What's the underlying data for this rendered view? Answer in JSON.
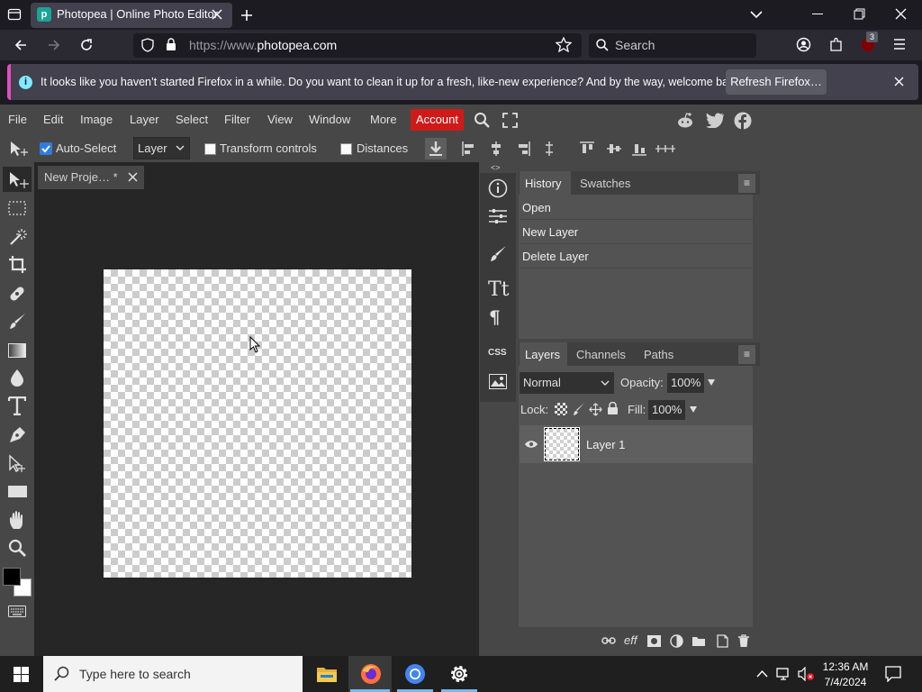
{
  "browser": {
    "tab_title": "Photopea | Online Photo Editor",
    "url_prefix": "https://www.",
    "url_host": "photopea.com",
    "search_placeholder": "Search",
    "extension_badge": "3",
    "notification": "It looks like you haven’t started Firefox in a while. Do you want to clean it up for a fresh, like-new experience? And by the way, welcome back!",
    "notification_button": "Refresh Firefox…"
  },
  "photopea": {
    "menu": [
      "File",
      "Edit",
      "Image",
      "Layer",
      "Select",
      "Filter",
      "View",
      "Window",
      "More"
    ],
    "account_label": "Account",
    "options": {
      "auto_select": "Auto-Select",
      "auto_select_checked": true,
      "target": "Layer",
      "transform_controls": "Transform controls",
      "distances": "Distances"
    },
    "document_tab": "New Proje… *",
    "side_strip_label": "CSS",
    "history_panel": {
      "tabs": [
        "History",
        "Swatches"
      ],
      "items": [
        "Open",
        "New Layer",
        "Delete Layer"
      ]
    },
    "layers_panel": {
      "tabs": [
        "Layers",
        "Channels",
        "Paths"
      ],
      "blend_mode": "Normal",
      "opacity_label": "Opacity:",
      "opacity": "100%",
      "lock_label": "Lock:",
      "fill_label": "Fill:",
      "fill": "100%",
      "layers": [
        {
          "name": "Layer 1",
          "visible": true
        }
      ]
    },
    "colors": {
      "foreground": "#000000",
      "background": "#ffffff",
      "account": "#cf1a1a"
    }
  },
  "taskbar": {
    "search_placeholder": "Type here to search",
    "time": "12:36 AM",
    "date": "7/4/2024"
  }
}
